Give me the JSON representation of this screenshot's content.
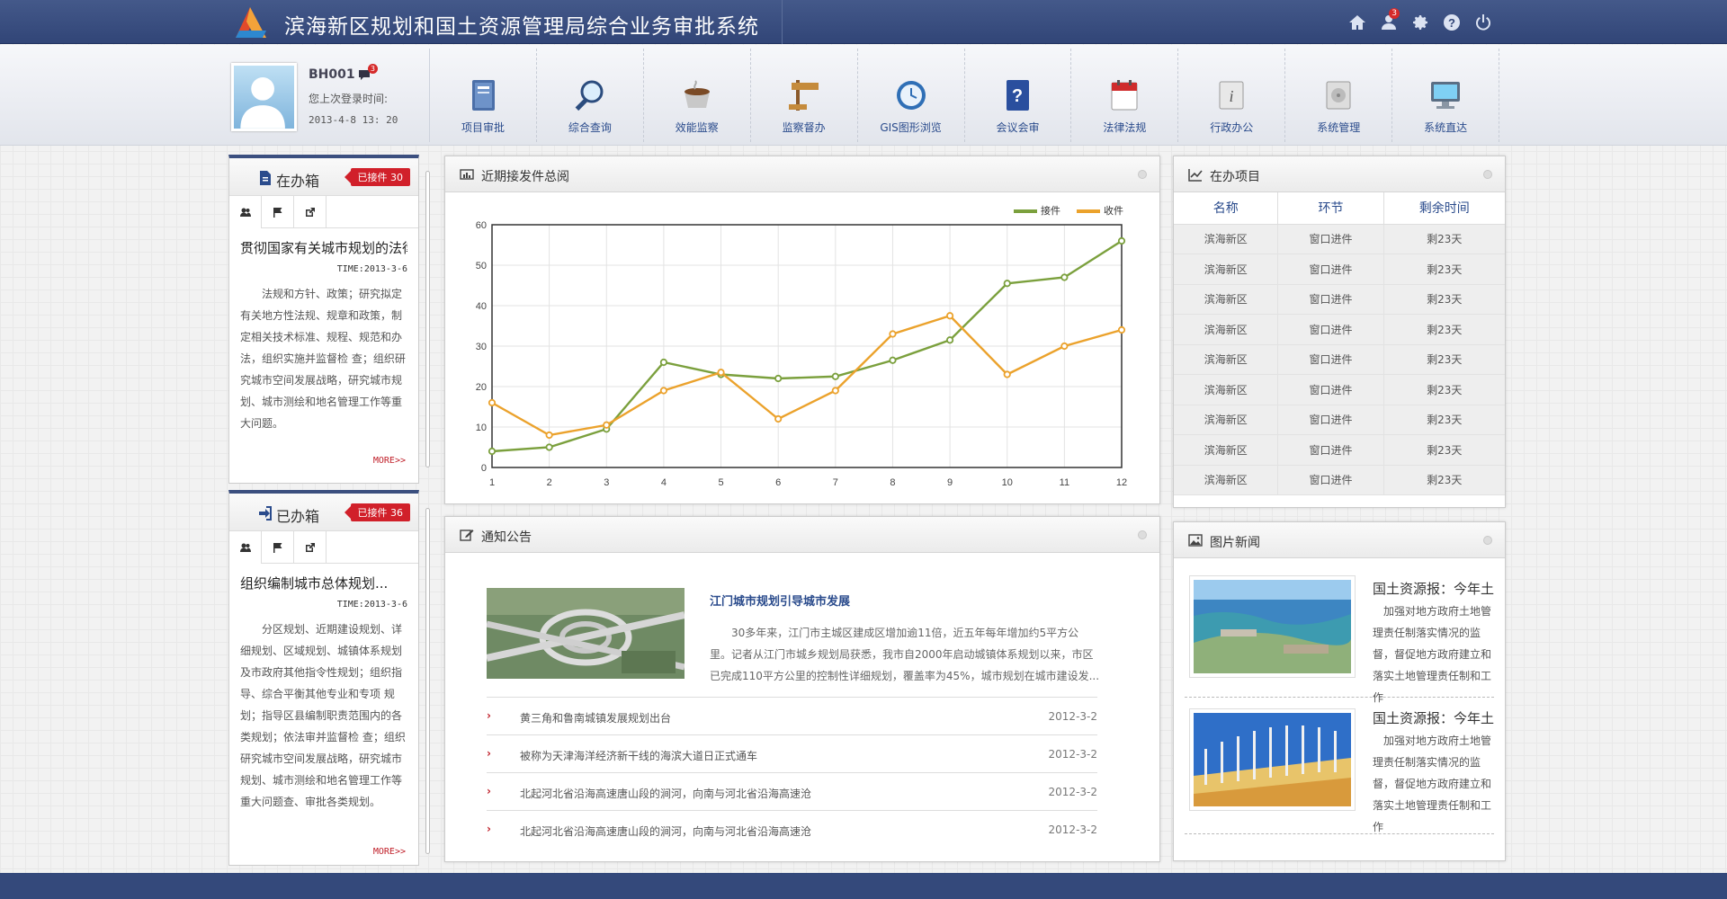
{
  "app": {
    "title": "滨海新区规划和国土资源管理局综合业务审批系统",
    "mail_badge": "3"
  },
  "top_icons": [
    "home-icon",
    "user-group-icon",
    "gear-icon",
    "help-icon",
    "power-icon"
  ],
  "user": {
    "name": "BH001",
    "badge": "3",
    "last_login_label": "您上次登录时间:",
    "last_login": "2013-4-8  13: 20"
  },
  "nav": [
    {
      "label": "项目审批",
      "icon": "book-icon"
    },
    {
      "label": "综合查询",
      "icon": "magnifier-icon"
    },
    {
      "label": "效能监察",
      "icon": "cup-icon"
    },
    {
      "label": "监察督办",
      "icon": "signpost-icon"
    },
    {
      "label": "GIS图形浏览",
      "icon": "clock-icon"
    },
    {
      "label": "会议会审",
      "icon": "question-book-icon"
    },
    {
      "label": "法律法规",
      "icon": "calendar-icon"
    },
    {
      "label": "行政办公",
      "icon": "info-icon"
    },
    {
      "label": "系统管理",
      "icon": "disk-icon"
    },
    {
      "label": "系统直达",
      "icon": "monitor-icon"
    }
  ],
  "inbox": {
    "title": "在办箱",
    "tag": "已接件  30",
    "item_title": "贯彻国家有关城市规划的法律",
    "time": "TIME:2013-3-6",
    "text": "法规和方针、政策；研究拟定有关地方性法规、规章和政策，制定相关技术标准、规程、规范和办法，组织实施并监督检 查；组织研究城市空间发展战略，研究城市规划、城市测绘和地名管理工作等重大问题。",
    "more": "MORE>>"
  },
  "done": {
    "title": "已办箱",
    "tag": "已接件  36",
    "item_title": "组织编制城市总体规划...",
    "time": "TIME:2013-3-6",
    "text": "分区规划、近期建设规划、详细规划、区域规划、城镇体系规划及市政府其他指令性规划；组织指导、综合平衡其他专业和专项 规划；指导区县编制职责范围内的各类规划；依法审并监督检 查；组织研究城市空间发展战略，研究城市规划、城市测绘和地名管理工作等重大问题查、审批各类规划。",
    "more": "MORE>>"
  },
  "chart_panel": {
    "title": "近期接发件总阅"
  },
  "chart_data": {
    "type": "line",
    "x": [
      1,
      2,
      3,
      4,
      5,
      6,
      7,
      8,
      9,
      10,
      11,
      12
    ],
    "series": [
      {
        "name": "接件",
        "color": "#7ba03d",
        "values": [
          4,
          5,
          9.5,
          26,
          23,
          22,
          22.5,
          26.5,
          31.5,
          45.5,
          47,
          56
        ]
      },
      {
        "name": "收件",
        "color": "#eba22c",
        "values": [
          16,
          8,
          10.5,
          19,
          23.5,
          12,
          19,
          33,
          37.5,
          23,
          30,
          34
        ]
      }
    ],
    "yticks": [
      0,
      10,
      20,
      30,
      40,
      50,
      60
    ],
    "ylim": [
      0,
      60
    ],
    "grid": true,
    "legend": "top-right"
  },
  "projects": {
    "title": "在办项目",
    "headers": [
      "名称",
      "环节",
      "剩余时间"
    ],
    "rows": [
      [
        "滨海新区",
        "窗口进件",
        "剩23天"
      ],
      [
        "滨海新区",
        "窗口进件",
        "剩23天"
      ],
      [
        "滨海新区",
        "窗口进件",
        "剩23天"
      ],
      [
        "滨海新区",
        "窗口进件",
        "剩23天"
      ],
      [
        "滨海新区",
        "窗口进件",
        "剩23天"
      ],
      [
        "滨海新区",
        "窗口进件",
        "剩23天"
      ],
      [
        "滨海新区",
        "窗口进件",
        "剩23天"
      ],
      [
        "滨海新区",
        "窗口进件",
        "剩23天"
      ],
      [
        "滨海新区",
        "窗口进件",
        "剩23天"
      ]
    ]
  },
  "notice": {
    "title": "通知公告",
    "headline": "江门城市规划引导城市发展",
    "summary": "30多年来，江门市主城区建成区增加逾11倍，近五年每年增加约5平方公里。记者从江门市城乡规划局获悉，我市自2000年启动城镇体系规划以来，市区已完成110平方公里的控制性详细规划，覆盖率为45%，城市规划在城市建设发...",
    "items": [
      {
        "text": "黄三角和鲁南城镇发展规划出台",
        "date": "2012-3-2"
      },
      {
        "text": "被称为天津海洋经济新干线的海滨大道日正式通车",
        "date": "2012-3-2"
      },
      {
        "text": "北起河北省沿海高速唐山段的涧河，向南与河北省沿海高速沧",
        "date": "2012-3-2"
      },
      {
        "text": "北起河北省沿海高速唐山段的涧河，向南与河北省沿海高速沧",
        "date": "2012-3-2"
      }
    ]
  },
  "photo_news": {
    "title": "图片新闻",
    "items": [
      {
        "title": "国土资源报：今年土",
        "text": "加强对地方政府土地管理责任制落实情况的监督，督促地方政府建立和落实土地管理责任制和工作"
      },
      {
        "title": "国土资源报：今年土",
        "text": "加强对地方政府土地管理责任制落实情况的监督，督促地方政府建立和落实土地管理责任制和工作"
      }
    ]
  }
}
